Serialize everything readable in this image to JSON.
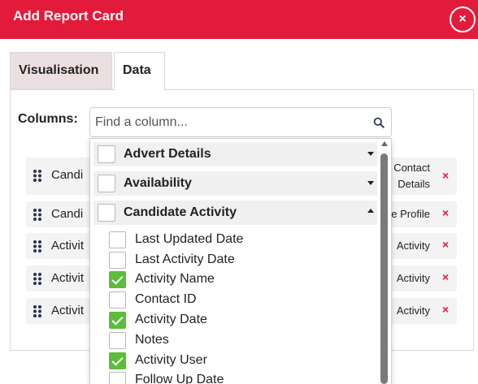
{
  "dialog": {
    "title": "Add Report Card",
    "close_symbol": "×"
  },
  "tabs": [
    {
      "label": "Visualisation"
    },
    {
      "label": "Data"
    }
  ],
  "columns_label": "Columns:",
  "search": {
    "placeholder": "Find a column..."
  },
  "selected_columns": [
    {
      "label": "Candi",
      "right": "Contact Details",
      "right_line1": "Contact",
      "right_line2": "Details",
      "remove": "×"
    },
    {
      "label": "Candi",
      "right": "e Profile",
      "remove": "×"
    },
    {
      "label": "Activit",
      "right": "Activity",
      "remove": "×"
    },
    {
      "label": "Activit",
      "right": "Activity",
      "remove": "×"
    },
    {
      "label": "Activit",
      "right": "Activity",
      "remove": "×"
    }
  ],
  "dropdown": {
    "groups": [
      {
        "label": "Advert Details",
        "expanded": false
      },
      {
        "label": "Availability",
        "expanded": false
      },
      {
        "label": "Candidate Activity",
        "expanded": true
      }
    ],
    "items": [
      {
        "label": "Last Updated Date",
        "checked": false
      },
      {
        "label": "Last Activity Date",
        "checked": false
      },
      {
        "label": "Activity Name",
        "checked": true
      },
      {
        "label": "Contact ID",
        "checked": false
      },
      {
        "label": "Activity Date",
        "checked": true
      },
      {
        "label": "Notes",
        "checked": false
      },
      {
        "label": "Activity User",
        "checked": true
      },
      {
        "label": "Follow Up Date",
        "checked": false
      }
    ]
  },
  "colors": {
    "brand": "#e31b3a",
    "check": "#5cbd3a"
  }
}
